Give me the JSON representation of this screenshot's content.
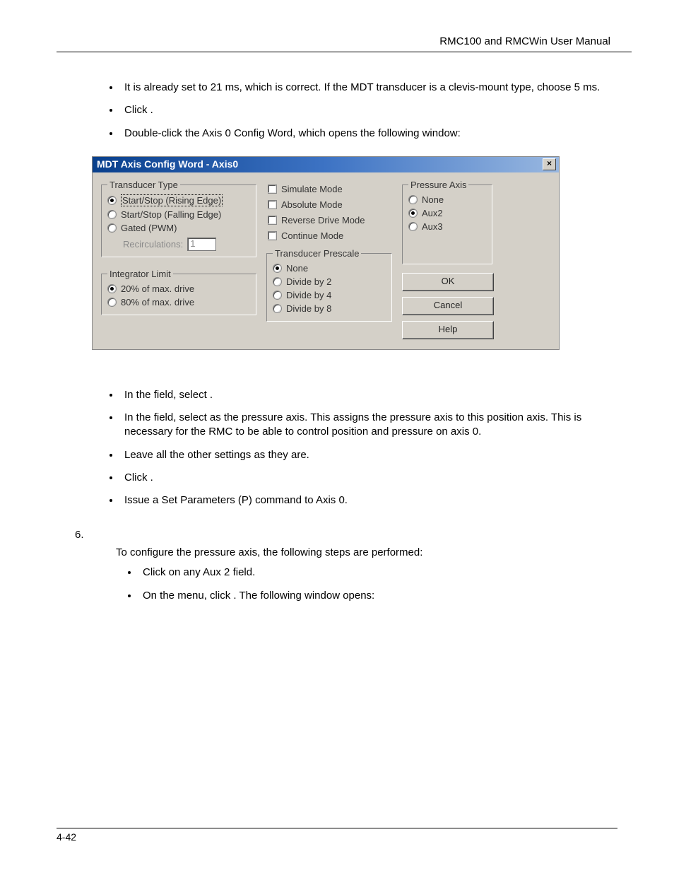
{
  "header": {
    "manual_title": "RMC100 and RMCWin User Manual"
  },
  "bullets_before": [
    "It is already set to 21 ms, which is correct. If the MDT transducer is a clevis-mount type, choose 5 ms.",
    "Click                        .",
    "Double-click the Axis 0 Config Word, which opens the following window:"
  ],
  "dialog": {
    "title": "MDT Axis Config Word - Axis0",
    "transducer_type": {
      "legend": "Transducer Type",
      "options": [
        "Start/Stop (Rising Edge)",
        "Start/Stop (Falling Edge)",
        "Gated (PWM)"
      ],
      "selected": 0,
      "recirc_label": "Recirculations:",
      "recirc_value": "1"
    },
    "integrator": {
      "legend": "Integrator Limit",
      "options": [
        "20% of max. drive",
        "80% of max. drive"
      ],
      "selected": 0
    },
    "checks": [
      "Simulate Mode",
      "Absolute Mode",
      "Reverse Drive Mode",
      "Continue Mode"
    ],
    "prescale": {
      "legend": "Transducer Prescale",
      "options": [
        "None",
        "Divide by 2",
        "Divide by 4",
        "Divide by 8"
      ],
      "selected": 0
    },
    "pressure_axis": {
      "legend": "Pressure Axis",
      "options": [
        "None",
        "Aux2",
        "Aux3"
      ],
      "selected": 1
    },
    "buttons": {
      "ok": "OK",
      "cancel": "Cancel",
      "help": "Help"
    }
  },
  "bullets_after": [
    "In the                               field, select                                           .",
    "In the                           field, select            as the pressure axis. This assigns the pressure axis to this position axis. This is necessary for the RMC to be able to control position and pressure on axis 0.",
    "Leave all the other settings as they are.",
    "Click       .",
    "Issue a Set Parameters (P) command to Axis 0."
  ],
  "step6": {
    "idx": "6.",
    "intro": "To configure the pressure axis, the following steps are performed:",
    "bullets": [
      "Click on any Aux 2 field.",
      "On the             menu, click                                        . The following window opens:"
    ]
  },
  "footer": {
    "page": "4-42"
  }
}
